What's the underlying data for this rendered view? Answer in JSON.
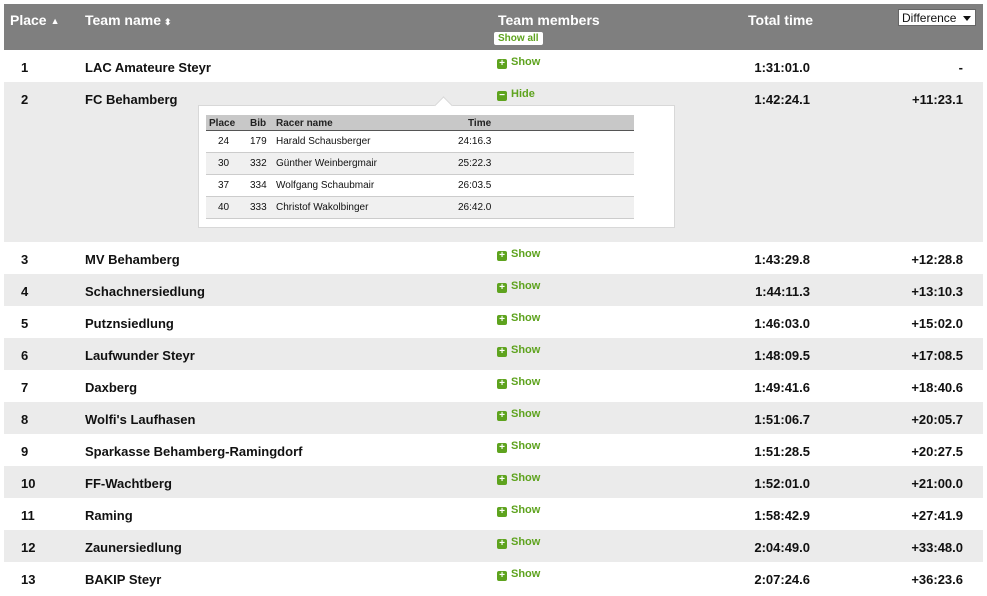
{
  "header": {
    "place": "Place",
    "place_sort": "▲",
    "team_name": "Team name",
    "team_sort": "⬍",
    "team_members": "Team members",
    "show_all": "Show all",
    "total_time": "Total time",
    "difference": "Difference"
  },
  "toggle": {
    "show": "Show",
    "hide": "Hide"
  },
  "rows": [
    {
      "place": "1",
      "team": "LAC Amateure Steyr",
      "toggle": "Show",
      "total": "1:31:01.0",
      "diff": "-"
    },
    {
      "place": "2",
      "team": "FC Behamberg",
      "toggle": "Hide",
      "total": "1:42:24.1",
      "diff": "+11:23.1"
    },
    {
      "place": "3",
      "team": "MV Behamberg",
      "toggle": "Show",
      "total": "1:43:29.8",
      "diff": "+12:28.8"
    },
    {
      "place": "4",
      "team": "Schachnersiedlung",
      "toggle": "Show",
      "total": "1:44:11.3",
      "diff": "+13:10.3"
    },
    {
      "place": "5",
      "team": "Putznsiedlung",
      "toggle": "Show",
      "total": "1:46:03.0",
      "diff": "+15:02.0"
    },
    {
      "place": "6",
      "team": "Laufwunder Steyr",
      "toggle": "Show",
      "total": "1:48:09.5",
      "diff": "+17:08.5"
    },
    {
      "place": "7",
      "team": "Daxberg",
      "toggle": "Show",
      "total": "1:49:41.6",
      "diff": "+18:40.6"
    },
    {
      "place": "8",
      "team": "Wolfi's Laufhasen",
      "toggle": "Show",
      "total": "1:51:06.7",
      "diff": "+20:05.7"
    },
    {
      "place": "9",
      "team": "Sparkasse Behamberg-Ramingdorf",
      "toggle": "Show",
      "total": "1:51:28.5",
      "diff": "+20:27.5"
    },
    {
      "place": "10",
      "team": "FF-Wachtberg",
      "toggle": "Show",
      "total": "1:52:01.0",
      "diff": "+21:00.0"
    },
    {
      "place": "11",
      "team": "Raming",
      "toggle": "Show",
      "total": "1:58:42.9",
      "diff": "+27:41.9"
    },
    {
      "place": "12",
      "team": "Zaunersiedlung",
      "toggle": "Show",
      "total": "2:04:49.0",
      "diff": "+33:48.0"
    },
    {
      "place": "13",
      "team": "BAKIP Steyr",
      "toggle": "Show",
      "total": "2:07:24.6",
      "diff": "+36:23.6"
    }
  ],
  "members": {
    "headers": {
      "place": "Place",
      "bib": "Bib",
      "name": "Racer name",
      "time": "Time"
    },
    "rows": [
      {
        "place": "24",
        "bib": "179",
        "name": "Harald Schausberger",
        "time": "24:16.3"
      },
      {
        "place": "30",
        "bib": "332",
        "name": "Günther Weinbergmair",
        "time": "25:22.3"
      },
      {
        "place": "37",
        "bib": "334",
        "name": "Wolfgang Schaubmair",
        "time": "26:03.5"
      },
      {
        "place": "40",
        "bib": "333",
        "name": "Christof Wakolbinger",
        "time": "26:42.0"
      }
    ]
  },
  "colors": {
    "header_bg": "#7f7f7f",
    "alt_row": "#ebebeb",
    "accent_green": "#5ea31e"
  }
}
